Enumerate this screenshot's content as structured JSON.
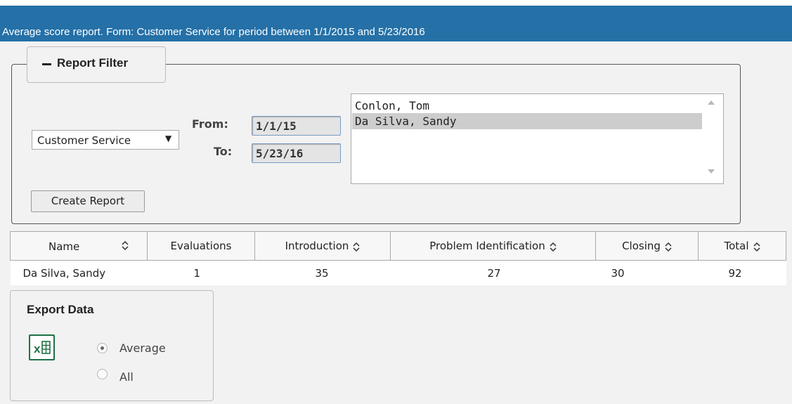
{
  "header": {
    "title": "Average score report. Form: Customer Service for period between 1/1/2015 and 5/23/2016"
  },
  "filter": {
    "legend": "Report Filter",
    "form_select": {
      "value": "Customer Service",
      "arrow": "▼"
    },
    "from_label": "From:",
    "to_label": "To:",
    "from_value": "1/1/15",
    "to_value": "5/23/16",
    "people": [
      {
        "label": "Conlon, Tom",
        "selected": false
      },
      {
        "label": "Da Silva, Sandy",
        "selected": true
      }
    ],
    "create_button": "Create Report"
  },
  "table": {
    "columns": [
      "Name",
      "Evaluations",
      "Introduction",
      "Problem Identification",
      "Closing",
      "Total"
    ],
    "rows": [
      [
        "Da Silva, Sandy",
        "1",
        "35",
        "27",
        "30",
        "92"
      ]
    ]
  },
  "export": {
    "title": "Export Data",
    "icon": "excel-icon",
    "options": [
      {
        "label": "Average",
        "checked": true
      },
      {
        "label": "All",
        "checked": false
      }
    ]
  },
  "colors": {
    "header_bg": "#2470a7",
    "excel_green": "#1e7145"
  }
}
